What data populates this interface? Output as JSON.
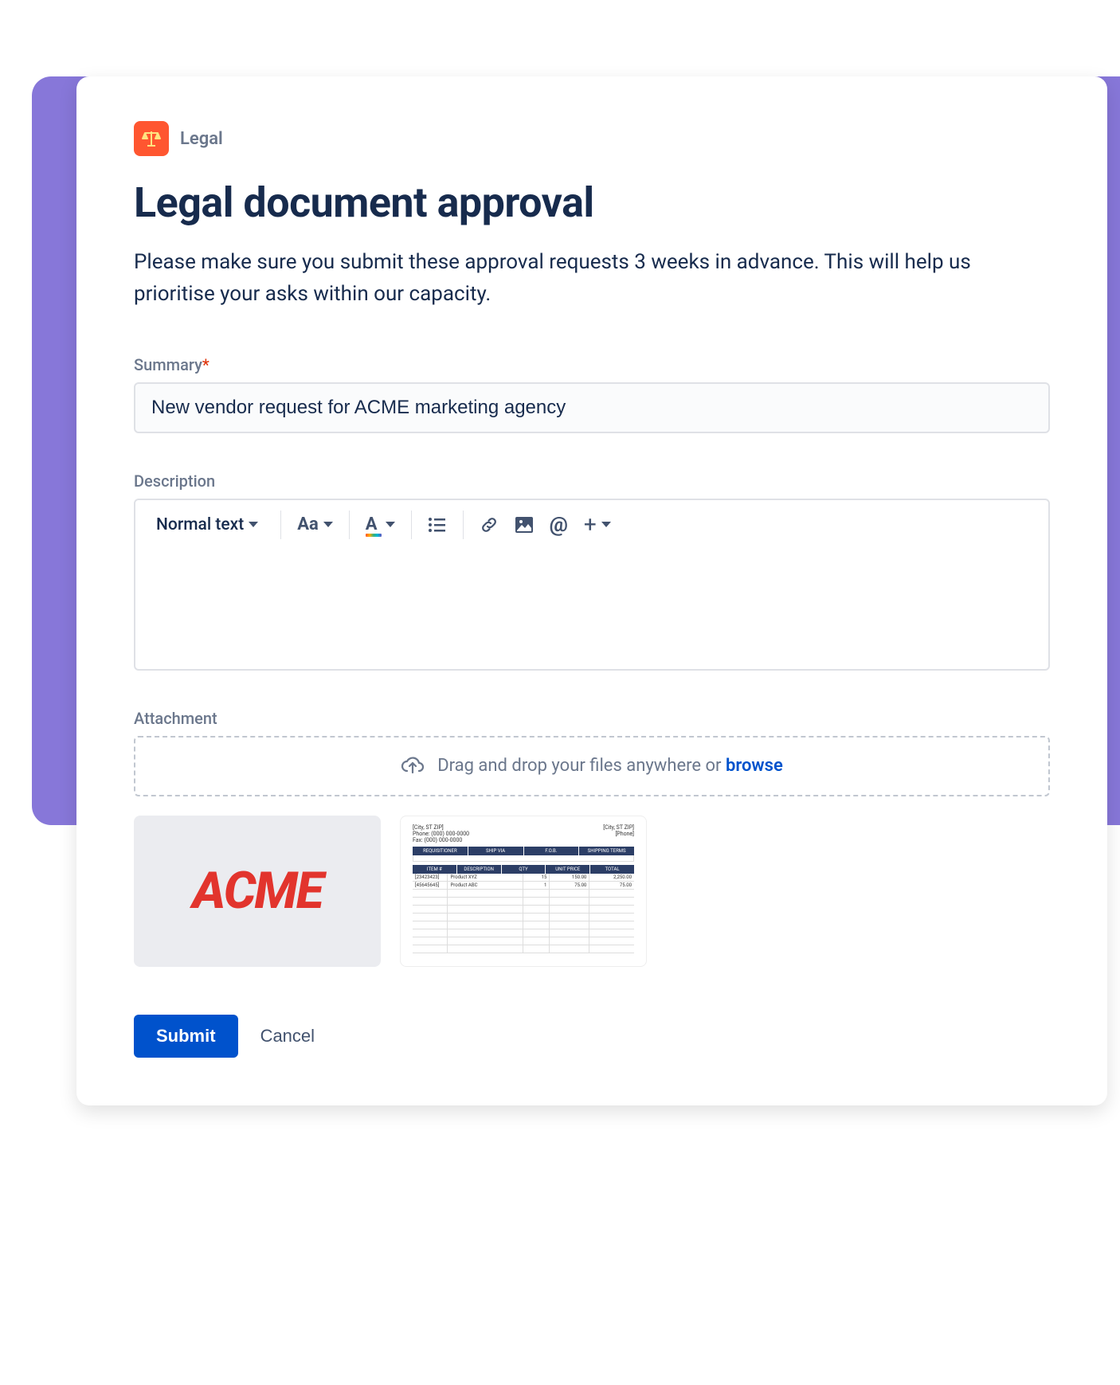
{
  "category": {
    "label": "Legal"
  },
  "title": "Legal document approval",
  "description": "Please make sure you submit these approval requests 3 weeks in advance. This will help us prioritise your asks within our capacity.",
  "fields": {
    "summary": {
      "label": "Summary",
      "required_marker": "*",
      "value": "New vendor request for ACME marketing agency"
    },
    "description": {
      "label": "Description"
    },
    "attachment": {
      "label": "Attachment",
      "dropzone_text": "Drag and drop your files anywhere or ",
      "dropzone_link": "browse"
    }
  },
  "editor": {
    "text_style": "Normal text",
    "format_btn": "Aa",
    "color_btn": "A"
  },
  "attachments": {
    "thumb1_text": "ACME",
    "invoice": {
      "addr1_lines": [
        "[City, ST ZIP]",
        "Phone: (000) 000-0000",
        "Fax: (000) 000-0000"
      ],
      "addr2_lines": [
        "[City, ST ZIP]",
        "[Phone]"
      ],
      "bar1": [
        "REQUISITIONER",
        "SHIP VIA",
        "F.O.B.",
        "SHIPPING TERMS"
      ],
      "bar2": [
        "ITEM #",
        "DESCRIPTION",
        "QTY",
        "UNIT PRICE",
        "TOTAL"
      ],
      "rows": [
        {
          "item": "[23423423]",
          "desc": "Product XYZ",
          "qty": "15",
          "price": "150.00",
          "total": "2,250.00"
        },
        {
          "item": "[45645645]",
          "desc": "Product ABC",
          "qty": "1",
          "price": "75.00",
          "total": "75.00"
        }
      ]
    }
  },
  "actions": {
    "submit": "Submit",
    "cancel": "Cancel"
  }
}
